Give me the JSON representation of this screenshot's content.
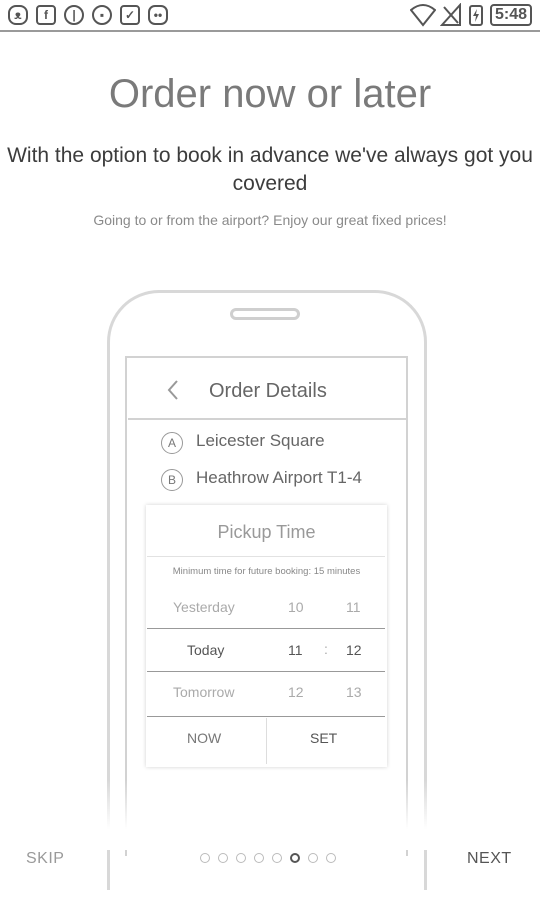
{
  "status_bar": {
    "left_icons": [
      "cat-face-icon",
      "facebook-icon",
      "circle-bar-icon",
      "lock-icon",
      "checkbox-icon",
      "android-icon"
    ],
    "right_icons": [
      "wifi-icon",
      "no-signal-icon",
      "battery-charging-icon"
    ],
    "time": "5:48"
  },
  "title": "Order now or later",
  "subtitle": "With the option to book in advance we've always got you covered",
  "caption": "Going to or from the airport? Enjoy our great fixed prices!",
  "phone_screen": {
    "header_title": "Order Details",
    "pickup": {
      "badge": "A",
      "name": "Leicester Square"
    },
    "dropoff": {
      "badge": "B",
      "name": "Heathrow Airport T1-4"
    },
    "card": {
      "title": "Pickup Time",
      "note": "Minimum time for future booking: 15 minutes",
      "rows": [
        {
          "day": "Yesterday",
          "hour": "10",
          "minute": "11"
        },
        {
          "day": "Today",
          "hour": "11",
          "sep": ":",
          "minute": "12"
        },
        {
          "day": "Tomorrow",
          "hour": "12",
          "minute": "13"
        }
      ],
      "now_label": "NOW",
      "set_label": "SET"
    }
  },
  "footer": {
    "skip_label": "SKIP",
    "next_label": "NEXT",
    "page_count": 8,
    "current_page": 6
  }
}
